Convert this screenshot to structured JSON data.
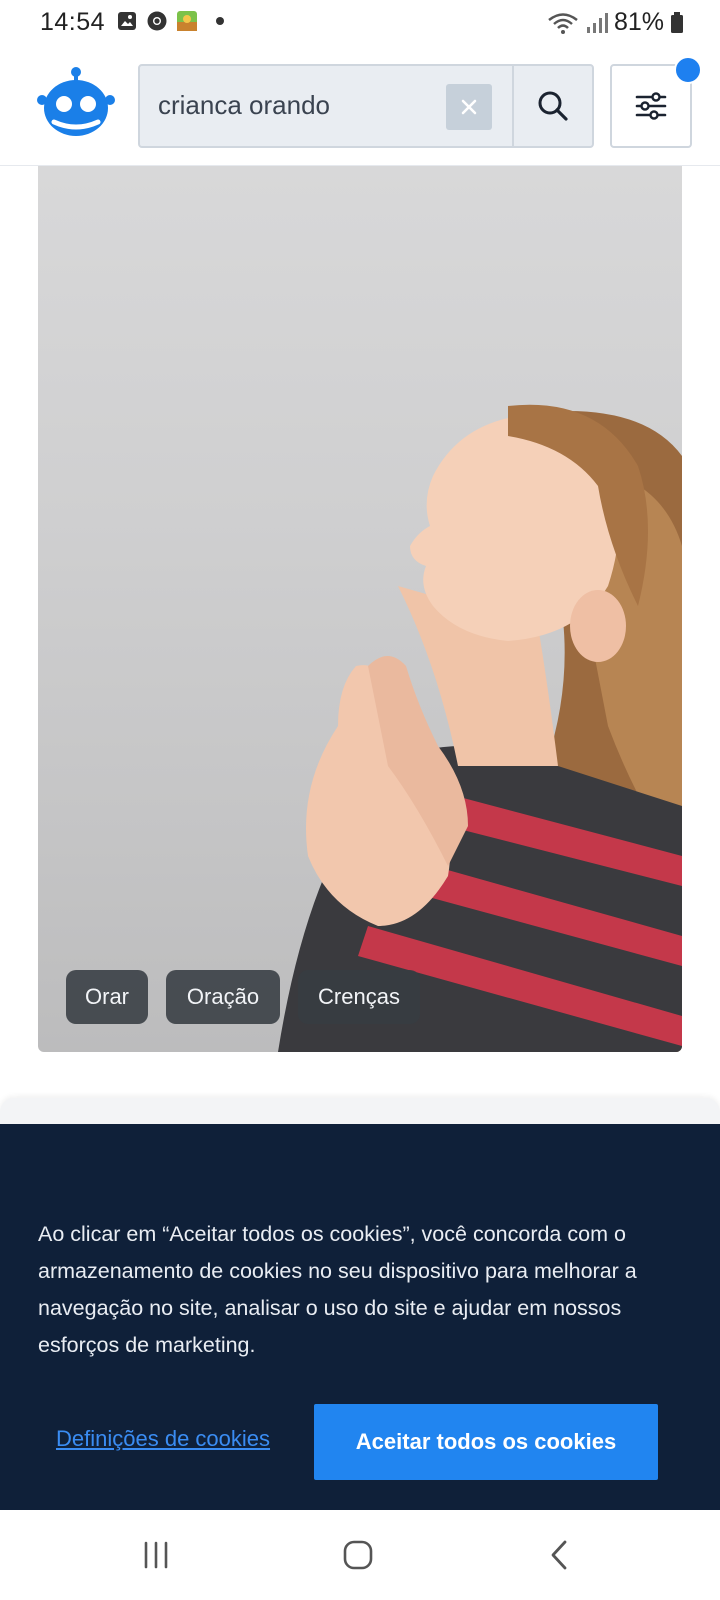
{
  "status_bar": {
    "time": "14:54",
    "battery": "81%"
  },
  "search": {
    "query": "crianca orando"
  },
  "image": {
    "tags": [
      "Orar",
      "Oração",
      "Crenças"
    ]
  },
  "cookie_banner": {
    "text": "Ao clicar em “Aceitar todos os cookies”, você concorda com o armazenamento de cookies no seu dispositivo para melhorar a navegação no site, analisar o uso do site e ajudar em nossos esforços de marketing.",
    "settings_label": "Definições de cookies",
    "accept_label": "Aceitar todos os cookies"
  },
  "colors": {
    "accent": "#2185f0",
    "banner_bg": "#0f2039"
  }
}
